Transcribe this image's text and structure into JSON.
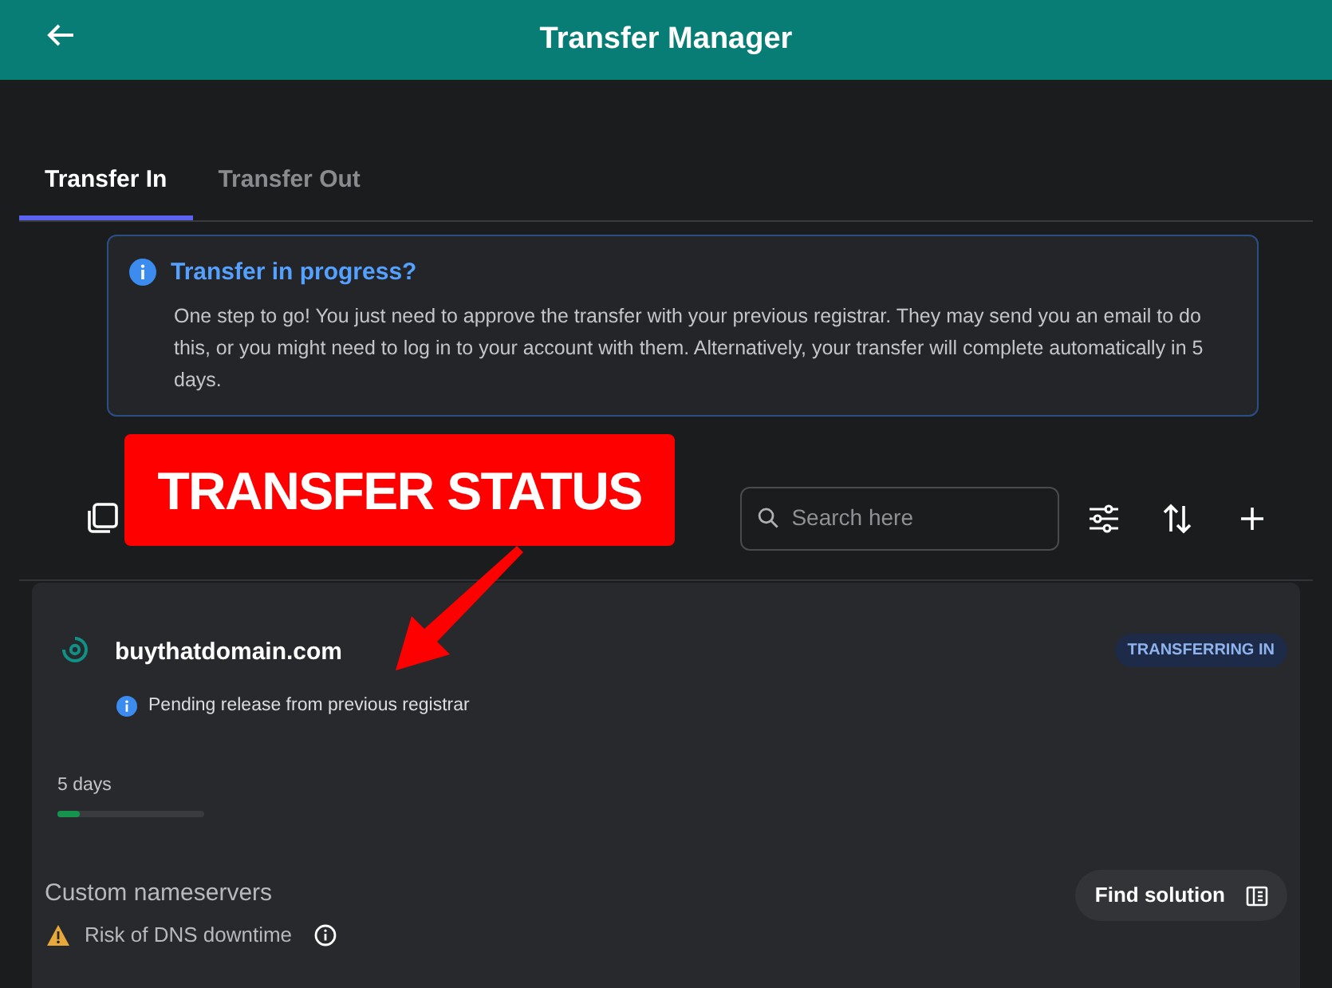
{
  "header": {
    "title": "Transfer Manager"
  },
  "tabs": [
    {
      "label": "Transfer In",
      "selected": true
    },
    {
      "label": "Transfer Out",
      "selected": false
    }
  ],
  "notice": {
    "title": "Transfer in progress?",
    "body": "One step to go! You just need to approve the transfer with your previous registrar. They may send you an email to do this, or you might need to log in to your account with them. Alternatively, your transfer will complete automatically in 5 days."
  },
  "search": {
    "placeholder": "Search here"
  },
  "annotation": {
    "label": "TRANSFER STATUS"
  },
  "domain": {
    "name": "buythatdomain.com",
    "badge": "TRANSFERRING IN",
    "status": "Pending release from previous registrar",
    "remaining": "5 days",
    "level": 0.15
  },
  "issue": {
    "title": "Custom nameservers",
    "warning": "Risk of DNS downtime",
    "action": "Find solution"
  }
}
